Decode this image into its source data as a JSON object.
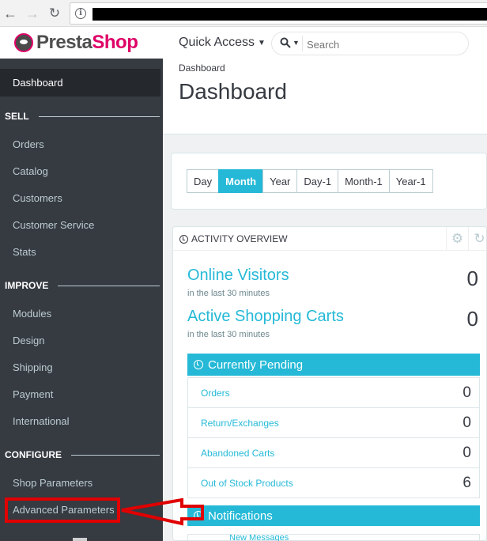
{
  "browser": {
    "back_icon": "back-arrow-icon",
    "forward_icon": "forward-arrow-icon",
    "reload_icon": "reload-icon",
    "info_icon": "info-icon"
  },
  "header": {
    "logo_prefix": "Presta",
    "logo_suffix": "Shop",
    "quick_access": "Quick Access",
    "search_placeholder": "Search"
  },
  "sidebar": {
    "active_item": "Dashboard",
    "sections": [
      {
        "title": "SELL",
        "items": [
          "Orders",
          "Catalog",
          "Customers",
          "Customer Service",
          "Stats"
        ]
      },
      {
        "title": "IMPROVE",
        "items": [
          "Modules",
          "Design",
          "Shipping",
          "Payment",
          "International"
        ]
      },
      {
        "title": "CONFIGURE",
        "items": [
          "Shop Parameters",
          "Advanced Parameters"
        ]
      }
    ]
  },
  "main": {
    "breadcrumb": "Dashboard",
    "title": "Dashboard",
    "periods": [
      "Day",
      "Month",
      "Year",
      "Day-1",
      "Month-1",
      "Year-1"
    ],
    "active_period": "Month"
  },
  "activity": {
    "title": "ACTIVITY OVERVIEW",
    "online_visitors_label": "Online Visitors",
    "online_visitors_sub": "in the last 30 minutes",
    "online_visitors_value": "0",
    "carts_label": "Active Shopping Carts",
    "carts_sub": "in the last 30 minutes",
    "carts_value": "0",
    "pending_title": "Currently Pending",
    "pending_rows": [
      {
        "label": "Orders",
        "value": "0"
      },
      {
        "label": "Return/Exchanges",
        "value": "0"
      },
      {
        "label": "Abandoned Carts",
        "value": "0"
      },
      {
        "label": "Out of Stock Products",
        "value": "6"
      }
    ],
    "notifications_title": "Notifications",
    "new_messages": "New Messages"
  },
  "colors": {
    "accent": "#25b9d7",
    "sidebar_bg": "#363a41",
    "annotation_red": "#e00000",
    "brand_pink": "#df0067"
  }
}
